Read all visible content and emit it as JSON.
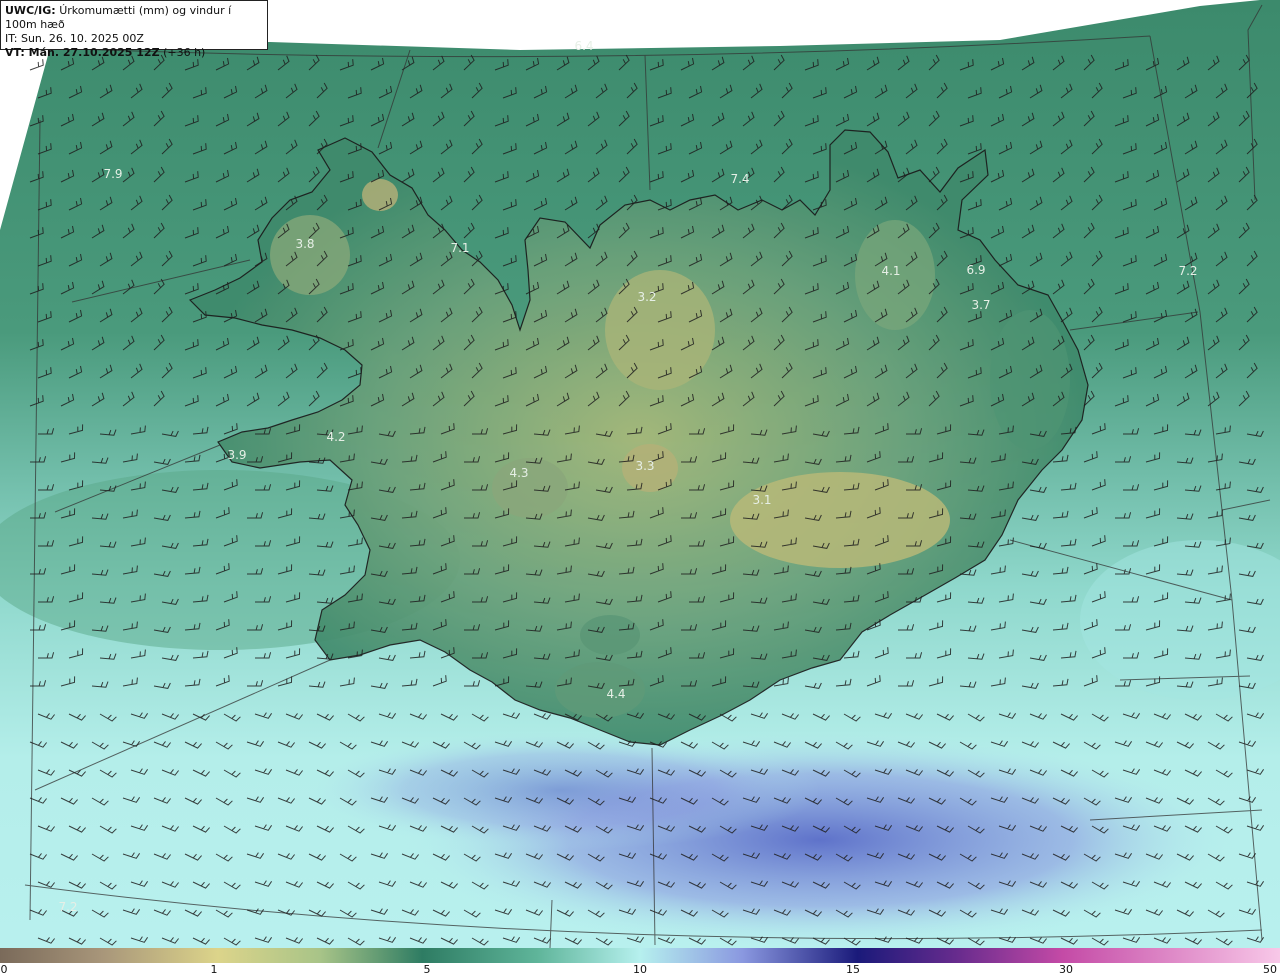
{
  "header": {
    "product": "UWC/IG:",
    "variable": "Úrkomumætti (mm) og vindur í 100m hæð",
    "init_time": "IT: Sun. 26. 10. 2025 00Z",
    "valid_prefix": "VT: Mán. 27.10.2025 12Z",
    "valid_suffix": "(+36 h)"
  },
  "colorbar": {
    "ticks": [
      "0",
      "1",
      "5",
      "10",
      "15",
      "30",
      "50"
    ],
    "colors": [
      "#7a6a5a",
      "#b8a878",
      "#dcd48a",
      "#6fae7e",
      "#2e7c63",
      "#5fb59a",
      "#b6f0ee",
      "#5b68c4",
      "#1a1a7a",
      "#6a2c8e",
      "#c44aa6",
      "#f0a8d8"
    ]
  },
  "map_labels": [
    {
      "text": "6.4"
    },
    {
      "text": "7.9"
    },
    {
      "text": "7.4"
    },
    {
      "text": "3.8"
    },
    {
      "text": "7.1"
    },
    {
      "text": "3.2"
    },
    {
      "text": "4.1"
    },
    {
      "text": "6.9"
    },
    {
      "text": "7.2"
    },
    {
      "text": "3.7"
    },
    {
      "text": "4.2"
    },
    {
      "text": "3.9"
    },
    {
      "text": "4.3"
    },
    {
      "text": "3.3"
    },
    {
      "text": "3.1"
    },
    {
      "text": "4.4"
    },
    {
      "text": "7.2"
    }
  ]
}
